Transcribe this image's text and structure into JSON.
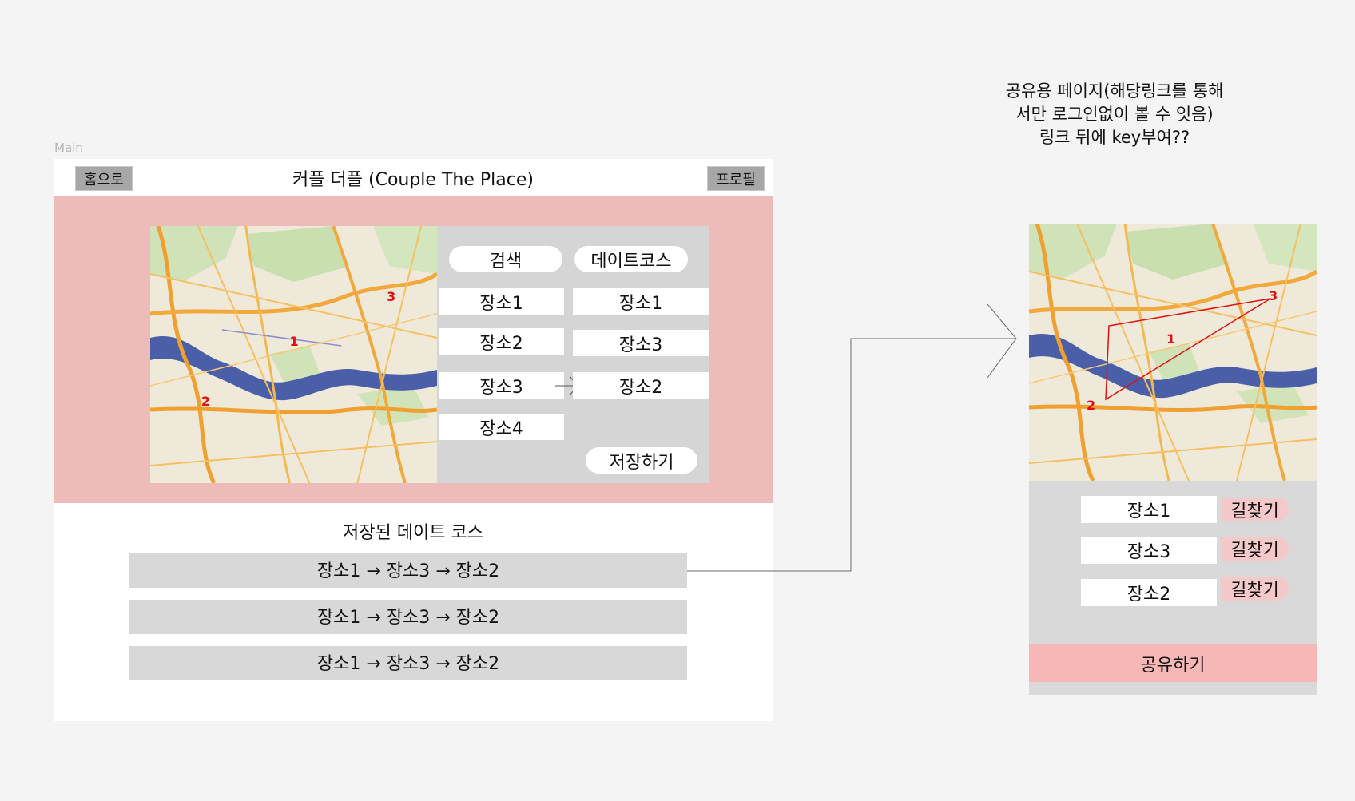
{
  "frame_label": "Main",
  "header": {
    "home_label": "홈으로",
    "title": "커플 더플 (Couple The Place)",
    "profile_label": "프로필"
  },
  "panel": {
    "search_label": "검색",
    "course_label": "데이트코스",
    "places": [
      "장소1",
      "장소2",
      "장소3",
      "장소4"
    ],
    "course": [
      "장소1",
      "장소3",
      "장소2"
    ],
    "save_label": "저장하기"
  },
  "map_markers": [
    "1",
    "2",
    "3"
  ],
  "saved": {
    "title": "저장된 데이트 코스",
    "rows": [
      "장소1 → 장소3 → 장소2",
      "장소1 → 장소3 → 장소2",
      "장소1 → 장소3 → 장소2"
    ]
  },
  "share_note": [
    "공유용 페이지(해당링크를 통해",
    "서만 로그인없이 볼 수 잇음)",
    "링크 뒤에 key부여??"
  ],
  "share": {
    "places": [
      "장소1",
      "장소3",
      "장소2"
    ],
    "route_label": "길찾기",
    "share_label": "공유하기"
  },
  "colors": {
    "band": "#eebbbb",
    "panel": "#d5d5d5",
    "share_button": "#f7b7b7",
    "route_button": "#f5c9c9",
    "marker": "#e01010"
  },
  "icons": {
    "arrow": "connector-arrow-icon"
  }
}
